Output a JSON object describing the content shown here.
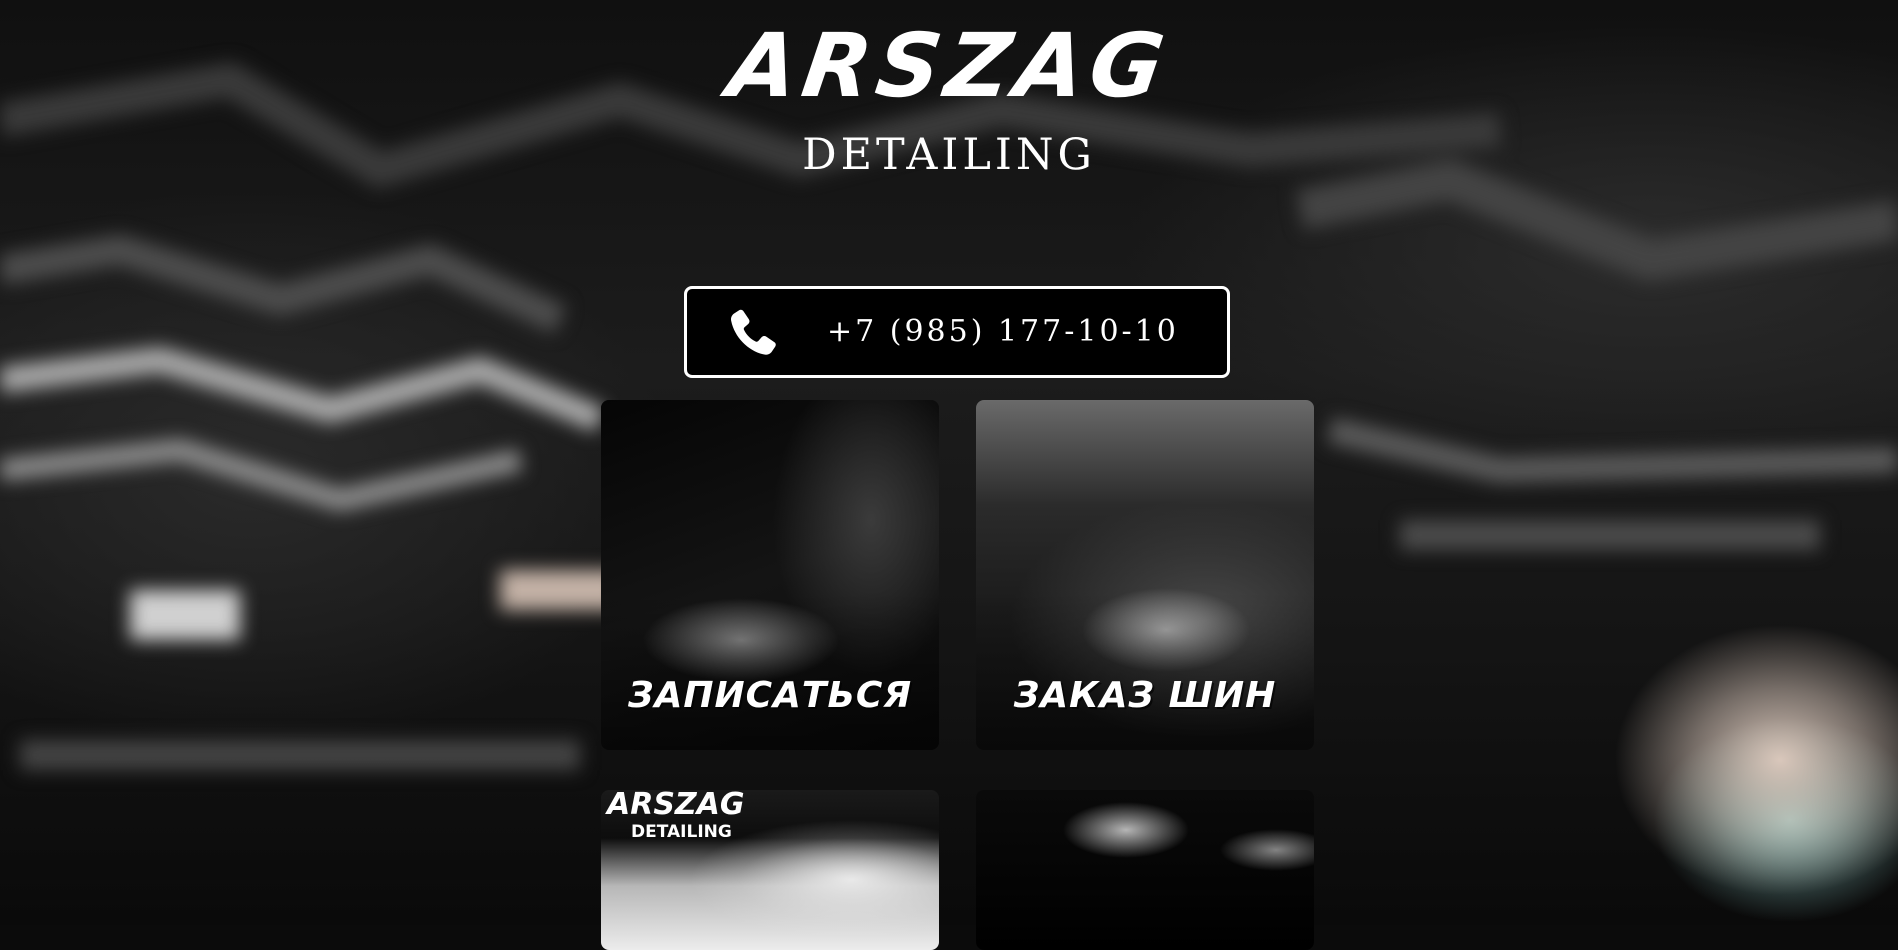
{
  "brand": {
    "logo_main": "ARSZAG",
    "logo_sub": "DETAILING"
  },
  "contact": {
    "phone_icon": "phone-icon",
    "phone": "+7 (985) 177-10-10"
  },
  "cards": [
    {
      "label": "ЗАПИСАТЬСЯ",
      "image": "car-hood-photo"
    },
    {
      "label": "ЗАКАЗ ШИН",
      "image": "car-headlight-photo"
    },
    {
      "label": "",
      "image": "garage-front-photo",
      "logo_main": "ARSZAG",
      "logo_sub": "DETAILING"
    },
    {
      "label": "",
      "image": "glossy-car-photo"
    }
  ],
  "colors": {
    "background": "#0b0b0b",
    "text": "#ffffff",
    "button_border": "#ffffff",
    "button_fill": "#000000"
  }
}
